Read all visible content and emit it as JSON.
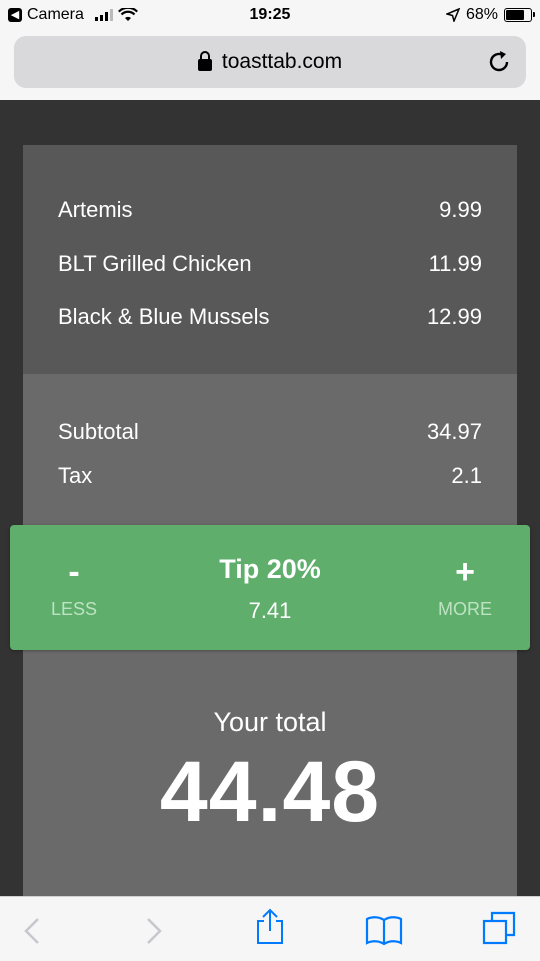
{
  "status_bar": {
    "back_app": "Camera",
    "time": "19:25",
    "battery": "68%",
    "battery_level": 0.68
  },
  "url_bar": {
    "domain": "toasttab.com"
  },
  "items": [
    {
      "name": "Artemis",
      "price": "9.99"
    },
    {
      "name": "BLT Grilled Chicken",
      "price": "11.99"
    },
    {
      "name": "Black & Blue Mussels",
      "price": "12.99"
    }
  ],
  "summary": {
    "subtotal_label": "Subtotal",
    "subtotal": "34.97",
    "tax_label": "Tax",
    "tax": "2.1"
  },
  "tip": {
    "decrease_symbol": "-",
    "decrease_label": "LESS",
    "title": "Tip 20%",
    "amount": "7.41",
    "increase_symbol": "+",
    "increase_label": "MORE"
  },
  "total": {
    "label": "Your total",
    "value": "44.48"
  },
  "toolbar": {
    "icons": [
      "back-arrow-icon",
      "forward-arrow-icon",
      "share-icon",
      "bookmarks-icon",
      "tabs-icon"
    ],
    "accent": "#007aff"
  },
  "colors": {
    "tip_green": "#5fae6c",
    "card": "#6b6a6b",
    "items_bg": "#585858",
    "page_bg": "#333333"
  }
}
